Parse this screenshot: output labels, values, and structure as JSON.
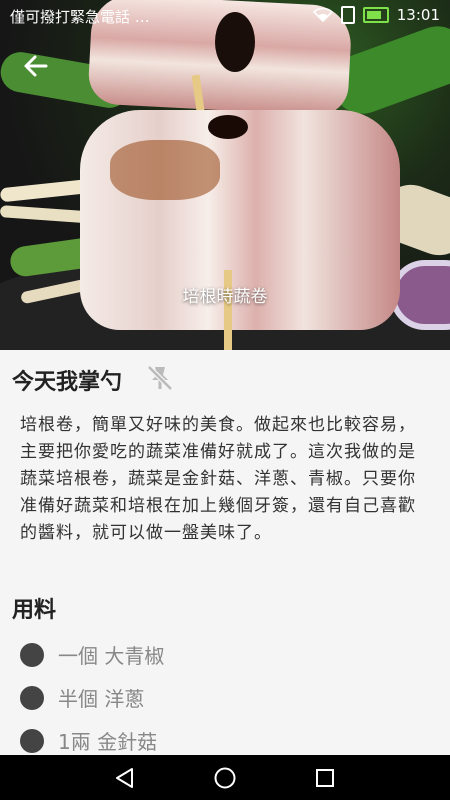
{
  "status_bar": {
    "carrier_text": "僅可撥打緊急電話 …",
    "time": "13:01",
    "icons": [
      "wifi-icon",
      "sim-icon",
      "battery-icon"
    ]
  },
  "header": {
    "back_icon": "arrow-left-icon",
    "image_caption": "培根時蔬卷"
  },
  "recipe": {
    "author": "今天我掌勺",
    "pin_icon": "pin-off-icon",
    "description": "培根卷，簡單又好味的美食。做起來也比較容易，主要把你愛吃的蔬菜准備好就成了。這次我做的是蔬菜培根卷，蔬菜是金針菇、洋蔥、青椒。只要你准備好蔬菜和培根在加上幾個牙簽，還有自己喜歡的醬料，就可以做一盤美味了。",
    "ingredients_title": "用料",
    "ingredients": [
      {
        "text": "一個 大青椒"
      },
      {
        "text": "半個 洋蔥"
      },
      {
        "text": "1兩 金針菇"
      }
    ]
  },
  "nav_bar": {
    "icons": [
      "back-triangle-icon",
      "home-circle-icon",
      "recents-square-icon"
    ]
  },
  "colors": {
    "background": "#f5f5f5",
    "text_dark": "#222222",
    "ingredient_text": "#888888",
    "bullet": "#444444",
    "battery": "#7ee14a"
  }
}
